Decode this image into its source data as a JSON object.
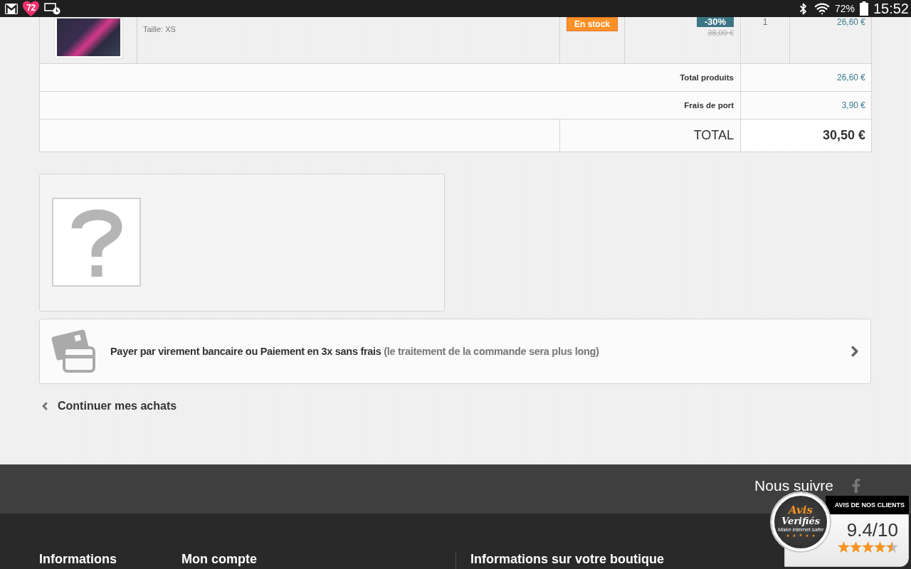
{
  "status_bar": {
    "notification_count": "72",
    "battery": "72%",
    "time": "15:52"
  },
  "cart_row": {
    "size": "Taille: XS",
    "availability": "En stock",
    "discount": "-30%",
    "old_price": "38,00 €",
    "quantity": "1",
    "total": "26,60 €"
  },
  "summary": [
    {
      "label": "Total produits",
      "value": "26,60 €"
    },
    {
      "label": "Frais de port",
      "value": "3,90 €"
    }
  ],
  "grand_total": {
    "label": "TOTAL",
    "value": "30,50 €"
  },
  "payment_option": {
    "label": "Payer par virement bancaire ou Paiement en 3x sans frais",
    "note": "(le traitement de la commande sera plus long)"
  },
  "continue_link": "Continuer mes achats",
  "footer": {
    "follow_label": "Nous suivre",
    "columns": [
      "Informations",
      "Mon compte",
      "Informations sur votre boutique"
    ]
  },
  "review_widget": {
    "logo_line_1": "Avis",
    "logo_line_2": "Verifiés",
    "logo_tagline": "Make internet safer",
    "header": "AVIS DE NOS CLIENTS",
    "score": "9.4/10",
    "stars": 4.5
  }
}
